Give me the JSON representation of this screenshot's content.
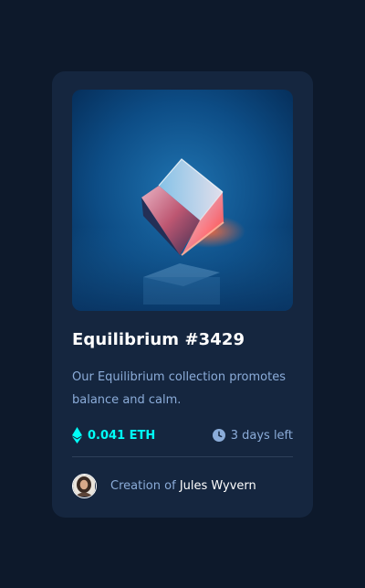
{
  "card": {
    "image_alt": "equilibrium-cube",
    "title": "Equilibrium #3429",
    "description": "Our Equilibrium collection promotes balance and calm.",
    "price": "0.041 ETH",
    "time_left": "3 days left",
    "creator_prefix": "Creation of ",
    "creator_name": "Jules Wyvern"
  },
  "icons": {
    "price": "ethereum-icon",
    "time": "clock-icon"
  },
  "colors": {
    "page_bg": "#0d192b",
    "card_bg": "#15263f",
    "accent_cyan": "#00fff8",
    "muted_text": "#8bacd9",
    "divider": "#2e405a",
    "white": "#ffffff"
  }
}
